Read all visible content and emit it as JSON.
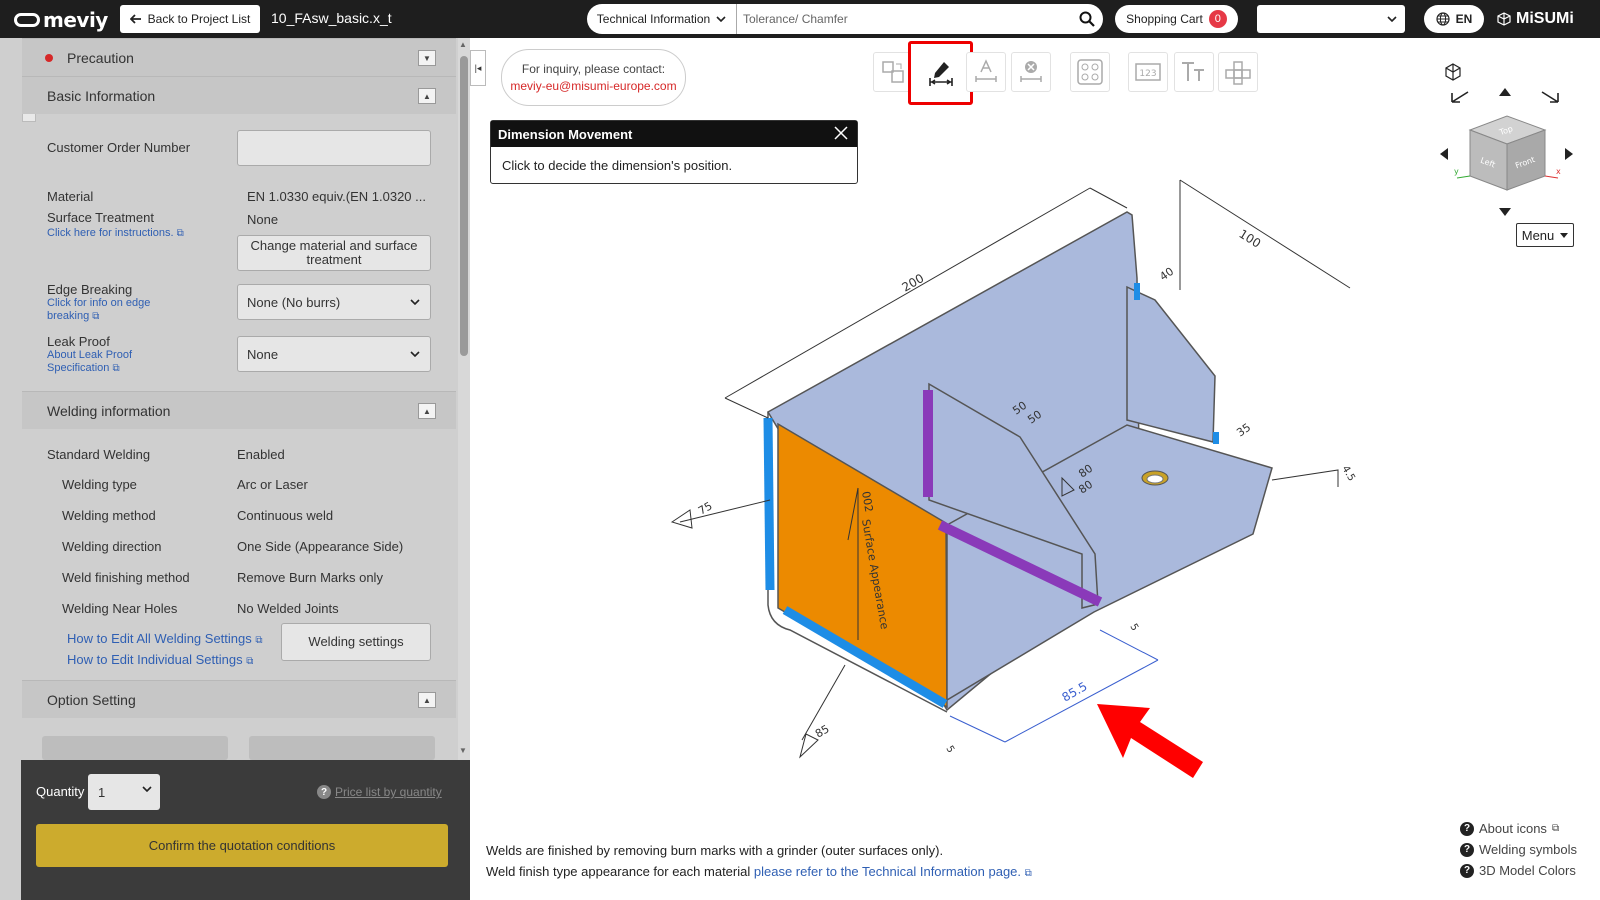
{
  "topbar": {
    "logo": "meviy",
    "back_label": "Back to Project List",
    "file_name": "10_FAsw_basic.x_t",
    "search_category": "Technical Information",
    "search_placeholder": "Tolerance/ Chamfer",
    "cart_label": "Shopping Cart",
    "cart_count": "0",
    "lang": "EN",
    "brand": "MiSUMi"
  },
  "sidebar": {
    "precaution": "Precaution",
    "basic_info": {
      "title": "Basic Information",
      "customer_order_label": "Customer Order Number",
      "customer_order_value": "",
      "material_label": "Material",
      "material_value": "EN 1.0330 equiv.(EN 1.0320 ...",
      "surface_label": "Surface Treatment",
      "surface_value": "None",
      "surface_link": "Click here for instructions.",
      "change_btn": "Change material and surface treatment",
      "edge_label": "Edge Breaking",
      "edge_link_1": "Click for info on edge",
      "edge_link_2": "breaking",
      "edge_value": "None (No burrs)",
      "leak_label": "Leak Proof",
      "leak_link_1": "About Leak Proof",
      "leak_link_2": "Specification",
      "leak_value": "None"
    },
    "welding": {
      "title": "Welding information",
      "rows": [
        {
          "label": "Standard Welding",
          "value": "Enabled"
        },
        {
          "label": "Welding type",
          "value": "Arc or Laser"
        },
        {
          "label": "Welding method",
          "value": "Continuous weld"
        },
        {
          "label": "Welding direction",
          "value": "One Side (Appearance Side)"
        },
        {
          "label": "Weld finishing method",
          "value": "Remove Burn Marks only"
        },
        {
          "label": "Welding Near Holes",
          "value": "No Welded Joints"
        }
      ],
      "link_all": "How to Edit All Welding Settings",
      "link_individual": "How to Edit Individual Settings",
      "settings_btn": "Welding settings"
    },
    "option": {
      "title": "Option Setting"
    },
    "bottom": {
      "qty_label": "Quantity",
      "qty_value": "1",
      "price_link": "Price list by quantity",
      "confirm": "Confirm the quotation conditions"
    }
  },
  "viewer": {
    "inquiry_line1": "For inquiry, please contact:",
    "inquiry_email": "meviy-eu@misumi-europe.com",
    "tooltip_title": "Dimension Movement",
    "tooltip_body": "Click to decide the dimension's position.",
    "menu_label": "Menu",
    "cube_faces": [
      "Top",
      "Left",
      "Front"
    ],
    "dims": {
      "d200": "200",
      "d100": "100",
      "d40": "40",
      "d35": "35",
      "d50a": "50",
      "d50b": "50",
      "d80a": "80",
      "d80b": "80",
      "d75": "75",
      "d85": "85",
      "d855": "85.5",
      "d45": "4.5",
      "d5a": "5",
      "d5b": "5",
      "surface": "Surface Appearance",
      "s002": "002"
    },
    "footer_line1": "Welds are finished by removing burn marks with a grinder (outer surfaces only).",
    "footer_line2_text": "Weld finish type appearance for each material",
    "footer_line2_link": "please refer to the Technical Information page.",
    "help_links": [
      "About icons",
      "Welding symbols",
      "3D Model Colors"
    ],
    "colors": {
      "plate": "#aab9dc",
      "orange": "#ec8a00",
      "blue": "#1e8de6",
      "purple": "#8a3ab9",
      "active_tool": "#e00000"
    }
  }
}
